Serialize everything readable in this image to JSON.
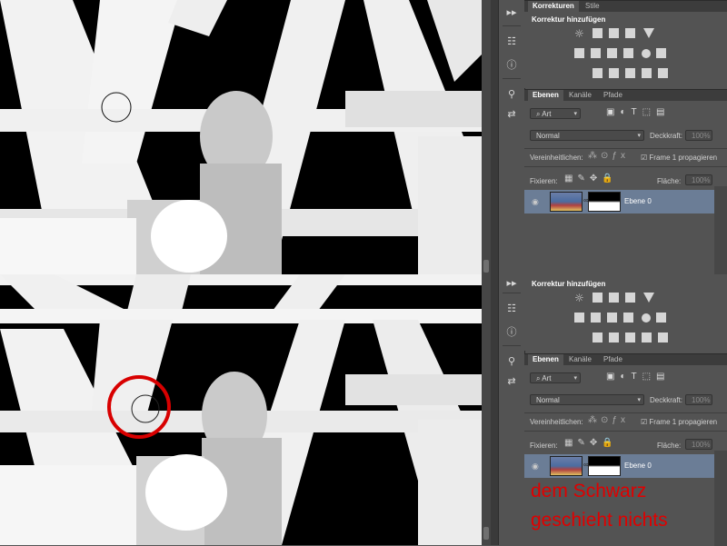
{
  "top": {
    "tabs": [
      {
        "label": "Korrekturen",
        "active": true
      },
      {
        "label": "Stile",
        "active": false
      }
    ],
    "adjust_title": "Korrektur hinzufügen",
    "layers": {
      "tabs": [
        {
          "label": "Ebenen",
          "active": true
        },
        {
          "label": "Kanäle",
          "active": false
        },
        {
          "label": "Pfade",
          "active": false
        }
      ],
      "filter_kind": "Art",
      "blend_mode": "Normal",
      "opacity_label": "Deckkraft:",
      "opacity_value": "100%",
      "unify_label": "Vereinheitlichen:",
      "propagate_label": "Frame 1 propagieren",
      "lock_label": "Fixieren:",
      "fill_label": "Fläche:",
      "fill_value": "100%",
      "layer_name": "Ebene 0"
    }
  },
  "bottom": {
    "adjust_title": "Korrektur hinzufügen",
    "layers": {
      "tabs": [
        {
          "label": "Ebenen",
          "active": true
        },
        {
          "label": "Kanäle",
          "active": false
        },
        {
          "label": "Pfade",
          "active": false
        }
      ],
      "filter_kind": "Art",
      "blend_mode": "Normal",
      "opacity_label": "Deckkraft:",
      "opacity_value": "100%",
      "unify_label": "Vereinheitlichen:",
      "propagate_label": "Frame 1 propagieren",
      "lock_label": "Fixieren:",
      "fill_label": "Fläche:",
      "fill_value": "100%",
      "layer_name": "Ebene 0"
    }
  },
  "annotation": {
    "line1": "dem Schwarz",
    "line2": "geschieht nichts",
    "color": "#e00000"
  },
  "colors": {
    "panel_bg": "#535353",
    "selected_layer": "#6b7d96",
    "circle_highlight": "#d80000"
  }
}
